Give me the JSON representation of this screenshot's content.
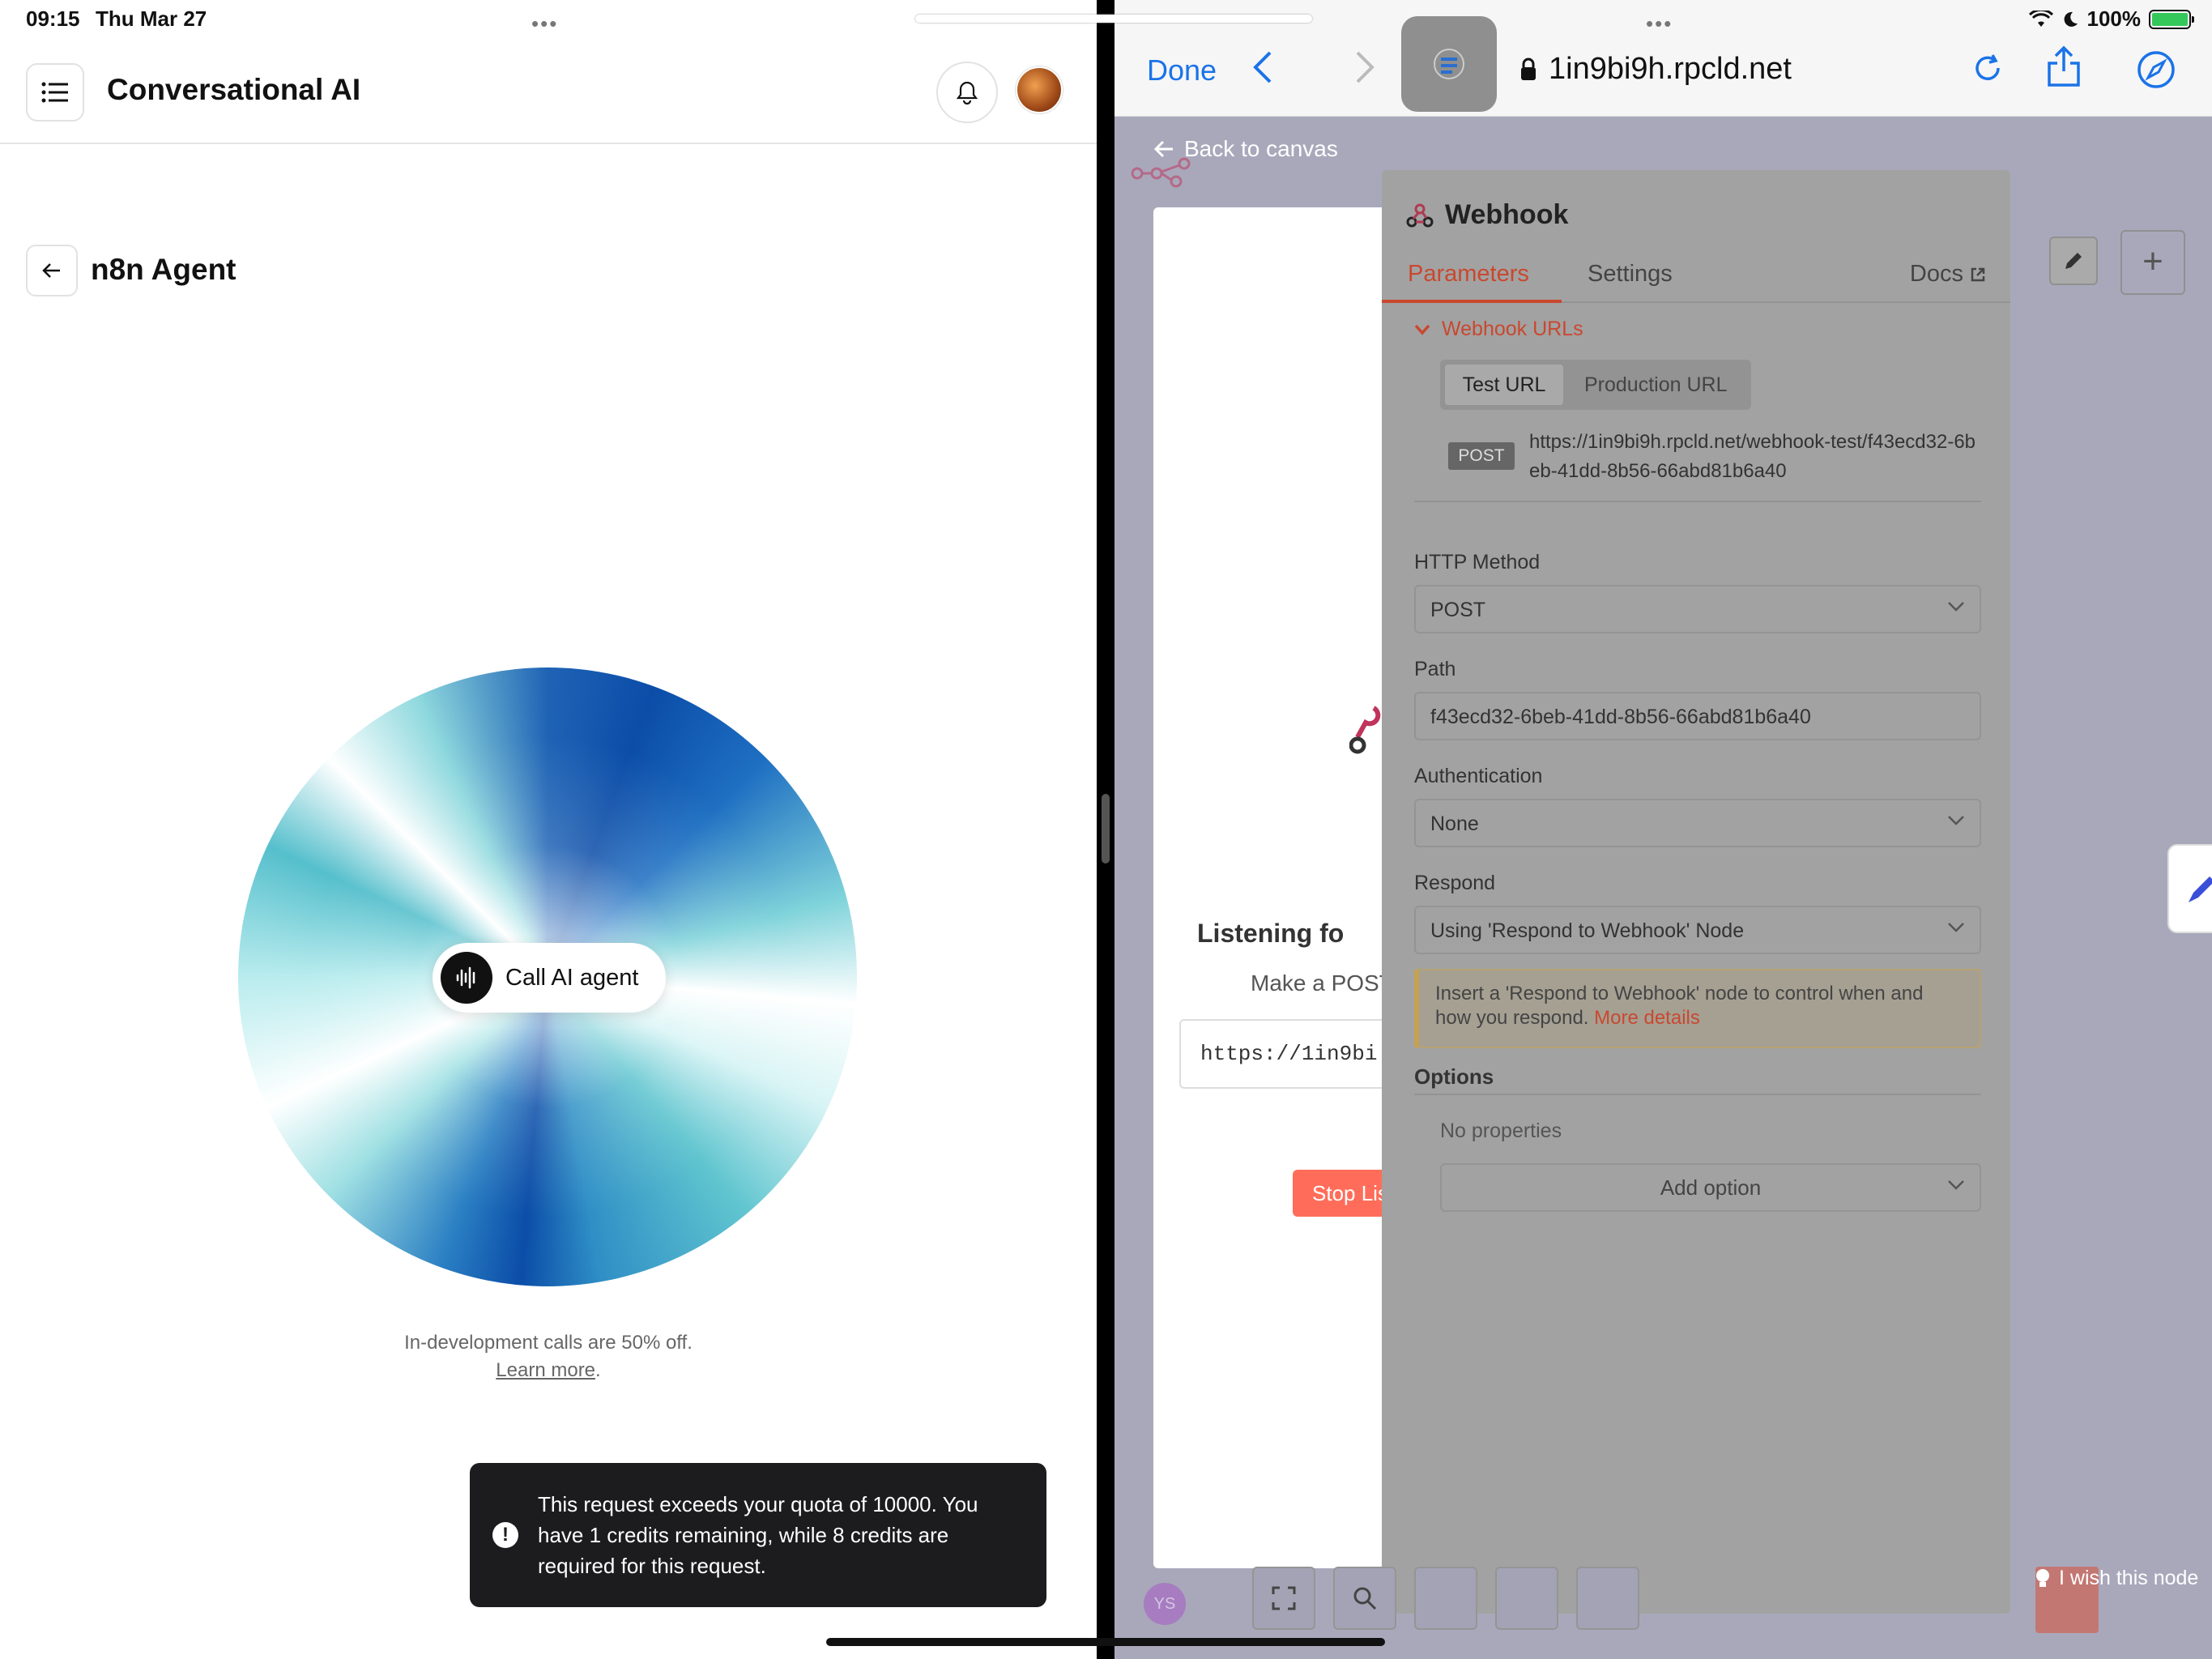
{
  "status": {
    "time": "09:15",
    "date": "Thu Mar 27",
    "battery": "100%"
  },
  "left": {
    "title": "Conversational AI",
    "agent_title": "n8n Agent",
    "call_button": "Call AI agent",
    "note": "In-development calls are 50% off.",
    "learn_more": "Learn more",
    "learn_more_suffix": ".",
    "toast": "This request exceeds your quota of 10000. You have 1 credits remaining, while 8 credits are required for this request."
  },
  "safari": {
    "done": "Done",
    "url": "1in9bi9h.rpcld.net"
  },
  "n8n": {
    "back_to_canvas": "Back to canvas",
    "listening_title": "Listening fo",
    "listening_sub": "Make a POST",
    "listening_url": "https://1in9bi",
    "stop_button": "Stop Lis",
    "panel": {
      "title": "Webhook",
      "tabs": [
        "Parameters",
        "Settings"
      ],
      "docs": "Docs",
      "section": "Webhook URLs",
      "url_toggle": [
        "Test URL",
        "Production URL"
      ],
      "method_badge": "POST",
      "webhook_url": "https://1in9bi9h.rpcld.net/webhook-test/f43ecd32-6beb-41dd-8b56-66abd81b6a40",
      "http_method_label": "HTTP Method",
      "http_method_value": "POST",
      "path_label": "Path",
      "path_value": "f43ecd32-6beb-41dd-8b56-66abd81b6a40",
      "auth_label": "Authentication",
      "auth_value": "None",
      "respond_label": "Respond",
      "respond_value": "Using 'Respond to Webhook' Node",
      "warning_text": "Insert a 'Respond to Webhook' node to control when and how you respond.",
      "warning_link": "More details",
      "options_label": "Options",
      "no_properties": "No properties",
      "add_option": "Add option"
    },
    "wish_text": "I wish this node",
    "avatar_initials": "YS"
  },
  "colors": {
    "n8n_accent": "#ff6d5a",
    "safari_blue": "#1a73e8",
    "toast_bg": "#1c1c1e"
  }
}
